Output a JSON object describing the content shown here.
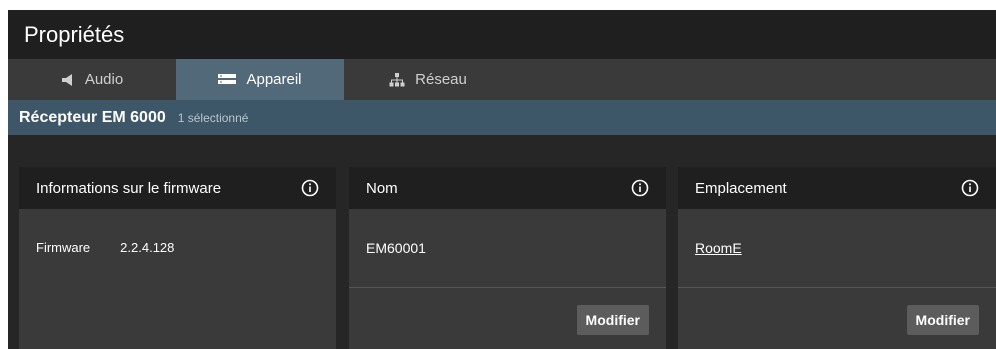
{
  "title": "Propriétés",
  "tabs": [
    {
      "label": "Audio",
      "icon": "speaker-icon",
      "active": false
    },
    {
      "label": "Appareil",
      "icon": "device-icon",
      "active": true
    },
    {
      "label": "Réseau",
      "icon": "network-icon",
      "active": false
    }
  ],
  "device": {
    "name": "Récepteur EM 6000",
    "selection": "1 sélectionné"
  },
  "cards": {
    "firmware": {
      "title": "Informations sur le firmware",
      "label": "Firmware",
      "value": "2.2.4.128"
    },
    "name": {
      "title": "Nom",
      "value": "EM60001",
      "button": "Modifier"
    },
    "location": {
      "title": "Emplacement",
      "value": "RoomE",
      "button": "Modifier"
    }
  },
  "colors": {
    "active_tab": "#52697a",
    "device_bar": "#3d5668",
    "card_header": "#1f1f1f",
    "card_body": "#3a3a3a"
  }
}
